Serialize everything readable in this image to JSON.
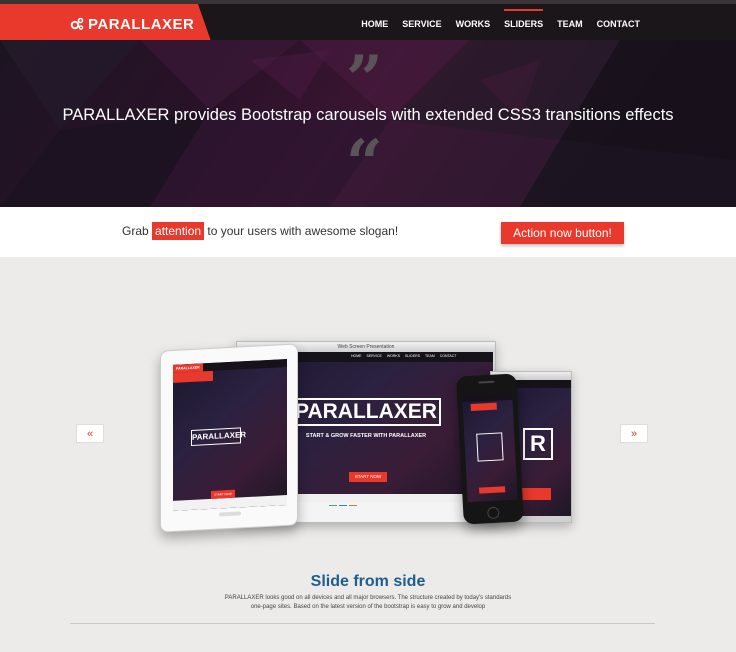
{
  "navbar": {
    "brand": "PARALLAXER",
    "items": [
      {
        "label": "HOME",
        "active": false
      },
      {
        "label": "SERVICE",
        "active": false
      },
      {
        "label": "WORKS",
        "active": false
      },
      {
        "label": "SLIDERS",
        "active": true
      },
      {
        "label": "TEAM",
        "active": false
      },
      {
        "label": "CONTACT",
        "active": false
      }
    ]
  },
  "hero": {
    "quote_open": "”",
    "quote_close": "“",
    "text": "PARALLAXER provides Bootstrap carousels with extended CSS3 transitions effects"
  },
  "slogan": {
    "before": "Grab ",
    "highlight": "attention",
    "after": " to your users with awesome slogan!",
    "button": "Action now button!"
  },
  "carousel": {
    "prev": "«",
    "next": "»",
    "mockup": {
      "window_title": "Web Screen Presentation",
      "brand": "PARALLAXER",
      "tagline": "START & GROW FASTER WITH PARALLAXER",
      "cta": "START NOW",
      "cta_small": "START NOW",
      "nav": [
        "HOME",
        "SERVICE",
        "WORKS",
        "SLIDERS",
        "TEAM",
        "CONTACT"
      ]
    },
    "slide_title": "Slide from side",
    "slide_desc_1": "PARALLAXER looks good on all devices and all major browsers. The structure created by today's standards",
    "slide_desc_2": "one-page sites. Based on the latest version of the bootstrap is easy to grow and develop"
  },
  "colors": {
    "accent": "#e8392c",
    "navbar_bg": "#1a1619",
    "title_blue": "#1f5e8c"
  }
}
